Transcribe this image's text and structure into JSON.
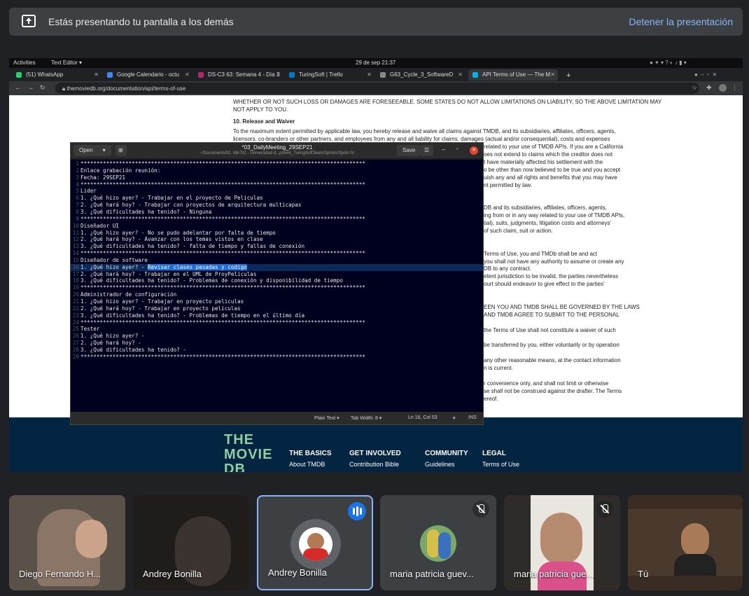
{
  "banner": {
    "message": "Estás presentando tu pantalla a los demás",
    "stop_label": "Detener la presentación"
  },
  "desktop": {
    "activities": "Activities",
    "app_menu": "Text Editor ▾",
    "clock": "29 de sep  21:37"
  },
  "browser": {
    "tabs": [
      {
        "label": "(51) WhatsApp",
        "color": "#25d366"
      },
      {
        "label": "Google Calendario - octu",
        "color": "#4285f4"
      },
      {
        "label": "DS-C3 63: Semana 4 - Día 3",
        "color": "#b0276a"
      },
      {
        "label": "TuringSoft | Trello",
        "color": "#0079bf"
      },
      {
        "label": "G63_Cycle_3_SoftwareD",
        "color": "#888888"
      },
      {
        "label": "API Terms of Use — The M",
        "color": "#01b4e4"
      }
    ],
    "url": "themoviedb.org/documentation/api/terms-of-use"
  },
  "webpage": {
    "lines_top": [
      "WHETHER OR NOT SUCH LOSS OR DAMAGES ARE FORESEEABLE. SOME STATES DO NOT ALLOW LIMITATIONS ON LIABILITY, SO THE ABOVE LIMITATION MAY",
      "NOT APPLY TO YOU."
    ],
    "heading": "10. Release and Waiver",
    "lines_main": [
      "To the maximum extent permitted by applicable law, you hereby release and waive all claims against TMDB, and its subsidiaries, affiliates, officers, agents,",
      "licensors, co-branders or other partners, and employees from any and all liability for claims, damages (actual and/or consequential), costs and expenses"
    ],
    "right_fragments": [
      "related to your use of TMDB APIs. If you are a California",
      "oes not extend to claims which the creditor does not",
      "t have materially affected his settlement with the",
      "o be other than now believed to be true and you accept",
      "uish any and all rights and benefits that you may have",
      "nt permitted by law.",
      "",
      "",
      "DB and its subsidiaries, affiliates, officers, agents,",
      "ing from or in any way related to your use of TMDB APIs,",
      "tial), suits, judgments, litigation costs and attorneys'",
      "of such claim, suit or action.",
      "",
      "",
      "Terms of Use, you and TMDb shall be and act",
      "you shall not have any authority to assume or create any",
      "DB to any contract.",
      "etent jurisdiction to be invalid, the parties nevertheless",
      "ourt should endeavor to give effect to the parties'",
      "",
      "",
      "EEN YOU AND TMDB SHALL BE GOVERNED BY THE LAWS",
      "AND TMDB AGREE TO SUBMIT TO THE PERSONAL",
      "",
      "the Terms of Use shall not constitute a waiver of such",
      "",
      "be transferred by you, either voluntarily or by operation",
      "",
      "any other reasonable means, at the contact information",
      "n is current.",
      "",
      "r convenience only, and shall not limit or otherwise",
      "se shall not be construed against the drafter. The Terms",
      "ereof."
    ],
    "footer": {
      "logo": [
        "THE",
        "MOVIE",
        "DB"
      ],
      "columns": [
        {
          "title": "THE BASICS",
          "item": "About TMDB"
        },
        {
          "title": "GET INVOLVED",
          "item": "Contribution Bible"
        },
        {
          "title": "COMMUNITY",
          "item": "Guidelines"
        },
        {
          "title": "LEGAL",
          "item": "Terms of Use"
        }
      ]
    }
  },
  "editor": {
    "open_label": "Open",
    "save_label": "Save",
    "filename": "*03_DailyMeeting_29SEP21",
    "path": "~/Documents/01. MinTIC - Universidad d...pment_TuringSoftTeam/Sprints/Sprint IV",
    "status": {
      "syntax": "Plain Text ▾",
      "tab_width": "Tab Width: 8 ▾",
      "position": "Ln 16, Col 53",
      "mode": "INS"
    },
    "cursor_line": 16,
    "lines": [
      "*****************************************************************************************",
      "Enlace grabación reunión:",
      "Fecha: 29SEP21",
      "*****************************************************************************************",
      "Lider",
      "1. ¿Qué hizo ayer? - Trabajar en el proyecto de Peliculas",
      "2. ¿Qué hará hoy? - Trabajar con proyectos de arquitectura multicapas",
      "3. ¿Qué dificultades ha tenido? - Ninguna",
      "*****************************************************************************************",
      "Diseñador UI",
      "1. ¿Qué hizo ayer? - No se pudo adelantar por falta de tiempo",
      "2. ¿Qué hará hoy? - Avanzar con los temas vistos en clase",
      "3. ¿Qué dificultades ha tenido? - falta de tiempo y fallas de conexión",
      "*****************************************************************************************",
      "Diseñador de software",
      "1. ¿Qué hizo ayer? - ",
      "2. ¿Qué hará hoy? - Trabajar en el UML de ProyPeliculas",
      "3. ¿Qué dificultades ha tenido? - Problemas de conexión y disponibilidad de tiempo",
      "*****************************************************************************************",
      "Administrador de configuración",
      "1. ¿Qué hizo ayer? - Trabajar en proyecto peliculas",
      "2. ¿Qué hará hoy? - Trabajar en proyecto peliculas",
      "3. ¿Qué dificultades ha tenido? - Problemas de tiempo en el último día",
      "*****************************************************************************************",
      "Tester",
      "1. ¿Qué hizo ayer? -",
      "2. ¿Qué hará hoy? -",
      "3. ¿Qué dificultades ha tenido? -",
      "*****************************************************************************************"
    ],
    "selected_text": "Revisar clases pasadas y codigo"
  },
  "participants": [
    {
      "name": "Diego Fernando H...",
      "state": "video"
    },
    {
      "name": "Andrey Bonilla",
      "state": "video-dark"
    },
    {
      "name": "Andrey Bonilla",
      "state": "speaking"
    },
    {
      "name": "maria patricia guev...",
      "state": "muted-avatar"
    },
    {
      "name": "maria patricia gue...",
      "state": "muted-video"
    },
    {
      "name": "Tú",
      "state": "video"
    }
  ],
  "colors": {
    "accent": "#8ab4f8",
    "speaking": "#1a73e8",
    "tmdb_navy": "#032541",
    "tmdb_green": "#90cea1",
    "tmdb_blue": "#01b4e4"
  }
}
